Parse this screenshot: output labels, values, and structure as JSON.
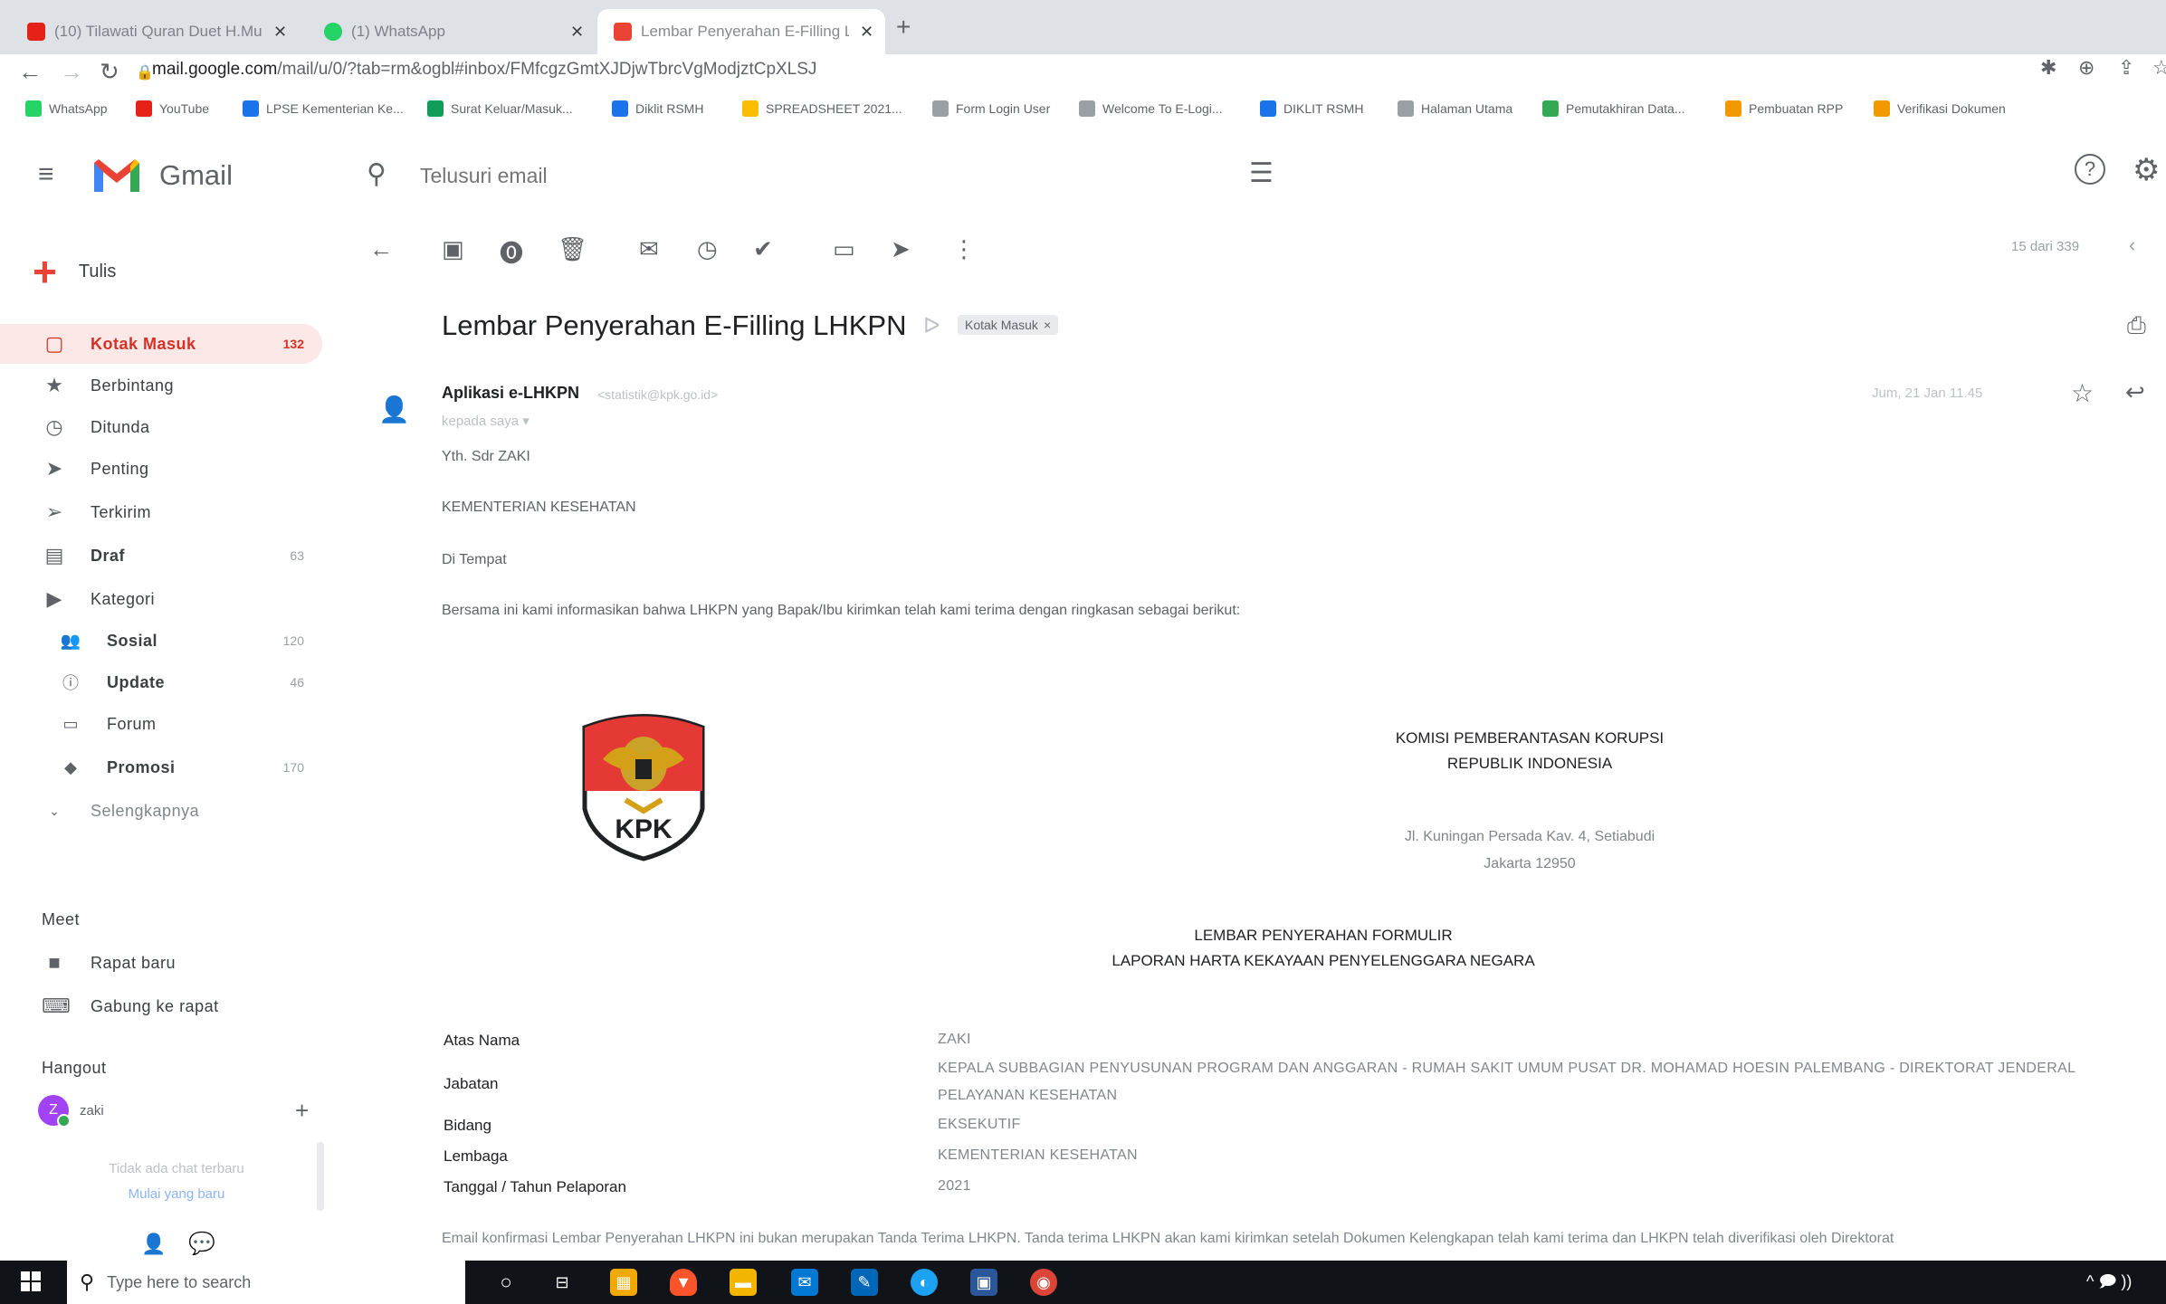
{
  "browser": {
    "tabs": [
      {
        "label": "(10) Tilawati Quran Duet H.Mu...",
        "icon_color": "#e62117"
      },
      {
        "label": "(1) WhatsApp",
        "icon_color": "#25d366"
      },
      {
        "label": "Lembar Penyerahan E-Filling LH...",
        "icon_color": "#ea4335",
        "active": true
      }
    ],
    "url": "mail.google.com/mail/u/0/?tab=rm&ogbl#inbox/FMfcgzGmtXJDjwTbrcVgModjztCpXLSJ",
    "url_host": "mail.google.com",
    "url_rest": "/mail/u/0/?tab=rm&ogbl#inbox/FMfcgzGmtXJDjwTbrcVgModjztCpXLSJ",
    "bookmarks": [
      {
        "label": "WhatsApp",
        "color": "#25d366"
      },
      {
        "label": "YouTube",
        "color": "#e62117"
      },
      {
        "label": "LPSE Kementerian Ke...",
        "color": "#1a73e8"
      },
      {
        "label": "Surat Keluar/Masuk...",
        "color": "#0f9d58"
      },
      {
        "label": "Diklit RSMH",
        "color": "#1a73e8"
      },
      {
        "label": "SPREADSHEET 2021...",
        "color": "#fbbc04"
      },
      {
        "label": "Form Login User",
        "color": "#9aa0a6"
      },
      {
        "label": "Welcome To E-Logi...",
        "color": "#9aa0a6"
      },
      {
        "label": "DIKLIT RSMH",
        "color": "#1a73e8"
      },
      {
        "label": "Halaman Utama",
        "color": "#9aa0a6"
      },
      {
        "label": "Pemutakhiran Data...",
        "color": "#34a853"
      },
      {
        "label": "Pembuatan RPP",
        "color": "#f29900"
      },
      {
        "label": "Verifikasi Dokumen",
        "color": "#f29900"
      }
    ]
  },
  "gmail": {
    "logo_text": "Gmail",
    "search_placeholder": "Telusuri email",
    "compose_label": "Tulis",
    "nav": [
      {
        "label": "Kotak Masuk",
        "count": "132",
        "icon": "inbox-icon",
        "glyph": "▢",
        "active": true
      },
      {
        "label": "Berbintang",
        "count": "",
        "icon": "star-icon",
        "glyph": "★"
      },
      {
        "label": "Ditunda",
        "count": "",
        "icon": "clock-icon",
        "glyph": "◷"
      },
      {
        "label": "Penting",
        "count": "",
        "icon": "important-icon",
        "glyph": "➤"
      },
      {
        "label": "Terkirim",
        "count": "",
        "icon": "send-icon",
        "glyph": "➢"
      },
      {
        "label": "Draf",
        "count": "63",
        "icon": "draft-icon",
        "glyph": "▤",
        "bold": true
      },
      {
        "label": "Kategori",
        "count": "",
        "icon": "label-icon",
        "glyph": "▶"
      }
    ],
    "categories": [
      {
        "label": "Sosial",
        "count": "120",
        "icon": "people-icon",
        "glyph": "👥"
      },
      {
        "label": "Update",
        "count": "46",
        "icon": "info-icon",
        "glyph": "ⓘ"
      },
      {
        "label": "Forum",
        "count": "",
        "icon": "forum-icon",
        "glyph": "▭"
      },
      {
        "label": "Promosi",
        "count": "170",
        "icon": "tag-icon",
        "glyph": "◆"
      }
    ],
    "more_label": "Selengkapnya",
    "meet": {
      "title": "Meet",
      "items": [
        {
          "label": "Rapat baru",
          "icon": "video-icon",
          "glyph": "■"
        },
        {
          "label": "Gabung ke rapat",
          "icon": "keyboard-icon",
          "glyph": "⌨"
        }
      ]
    },
    "hangout": {
      "title": "Hangout",
      "user": "zaki",
      "avatar_letter": "Z",
      "no_chat": "Tidak ada chat terbaru",
      "new_chat": "Mulai yang baru"
    },
    "pager": "15 dari 339"
  },
  "message": {
    "subject": "Lembar Penyerahan E-Filling LHKPN",
    "label": "Kotak Masuk",
    "sender_name": "Aplikasi e-LHKPN",
    "sender_email": "<statistik@kpk.go.id>",
    "to_line": "kepada saya ▾",
    "date": "Jum, 21 Jan 11.45",
    "body": [
      "Yth. Sdr ZAKI",
      "KEMENTERIAN KESEHATAN",
      "Di Tempat",
      "Bersama ini kami informasikan bahwa LHKPN yang Bapak/Ibu kirimkan telah kami terima dengan ringkasan sebagai berikut:"
    ],
    "logo_text": "KPK",
    "org_name_1": "KOMISI PEMBERANTASAN KORUPSI",
    "org_name_2": "REPUBLIK INDONESIA",
    "address_1": "Jl. Kuningan Persada Kav. 4, Setiabudi",
    "address_2": "Jakarta 12950",
    "doc_title_1": "LEMBAR PENYERAHAN FORMULIR",
    "doc_title_2": "LAPORAN HARTA KEKAYAAN PENYELENGGARA NEGARA",
    "fields": [
      {
        "label": "Atas Nama",
        "value": "ZAKI"
      },
      {
        "label": "Jabatan",
        "value": "KEPALA SUBBAGIAN PENYUSUNAN PROGRAM DAN ANGGARAN - RUMAH SAKIT UMUM PUSAT DR. MOHAMAD HOESIN PALEMBANG - DIREKTORAT JENDERAL",
        "value_2": "PELAYANAN KESEHATAN"
      },
      {
        "label": "Bidang",
        "value": "EKSEKUTIF"
      },
      {
        "label": "Lembaga",
        "value": "KEMENTERIAN KESEHATAN"
      },
      {
        "label": "Tanggal / Tahun Pelaporan",
        "value": "2021"
      }
    ],
    "footer_note": "Email konfirmasi Lembar Penyerahan LHKPN ini bukan merupakan Tanda Terima LHKPN. Tanda terima LHKPN akan kami kirimkan setelah Dokumen Kelengkapan telah kami terima dan LHKPN telah diverifikasi oleh Direktorat"
  },
  "taskbar": {
    "search_placeholder": "Type here to search",
    "tray_text": "^ 🗩 ))"
  },
  "colors": {
    "accent_red": "#d93025",
    "active_bg": "#fce8e6",
    "taskbar": "#101418"
  }
}
